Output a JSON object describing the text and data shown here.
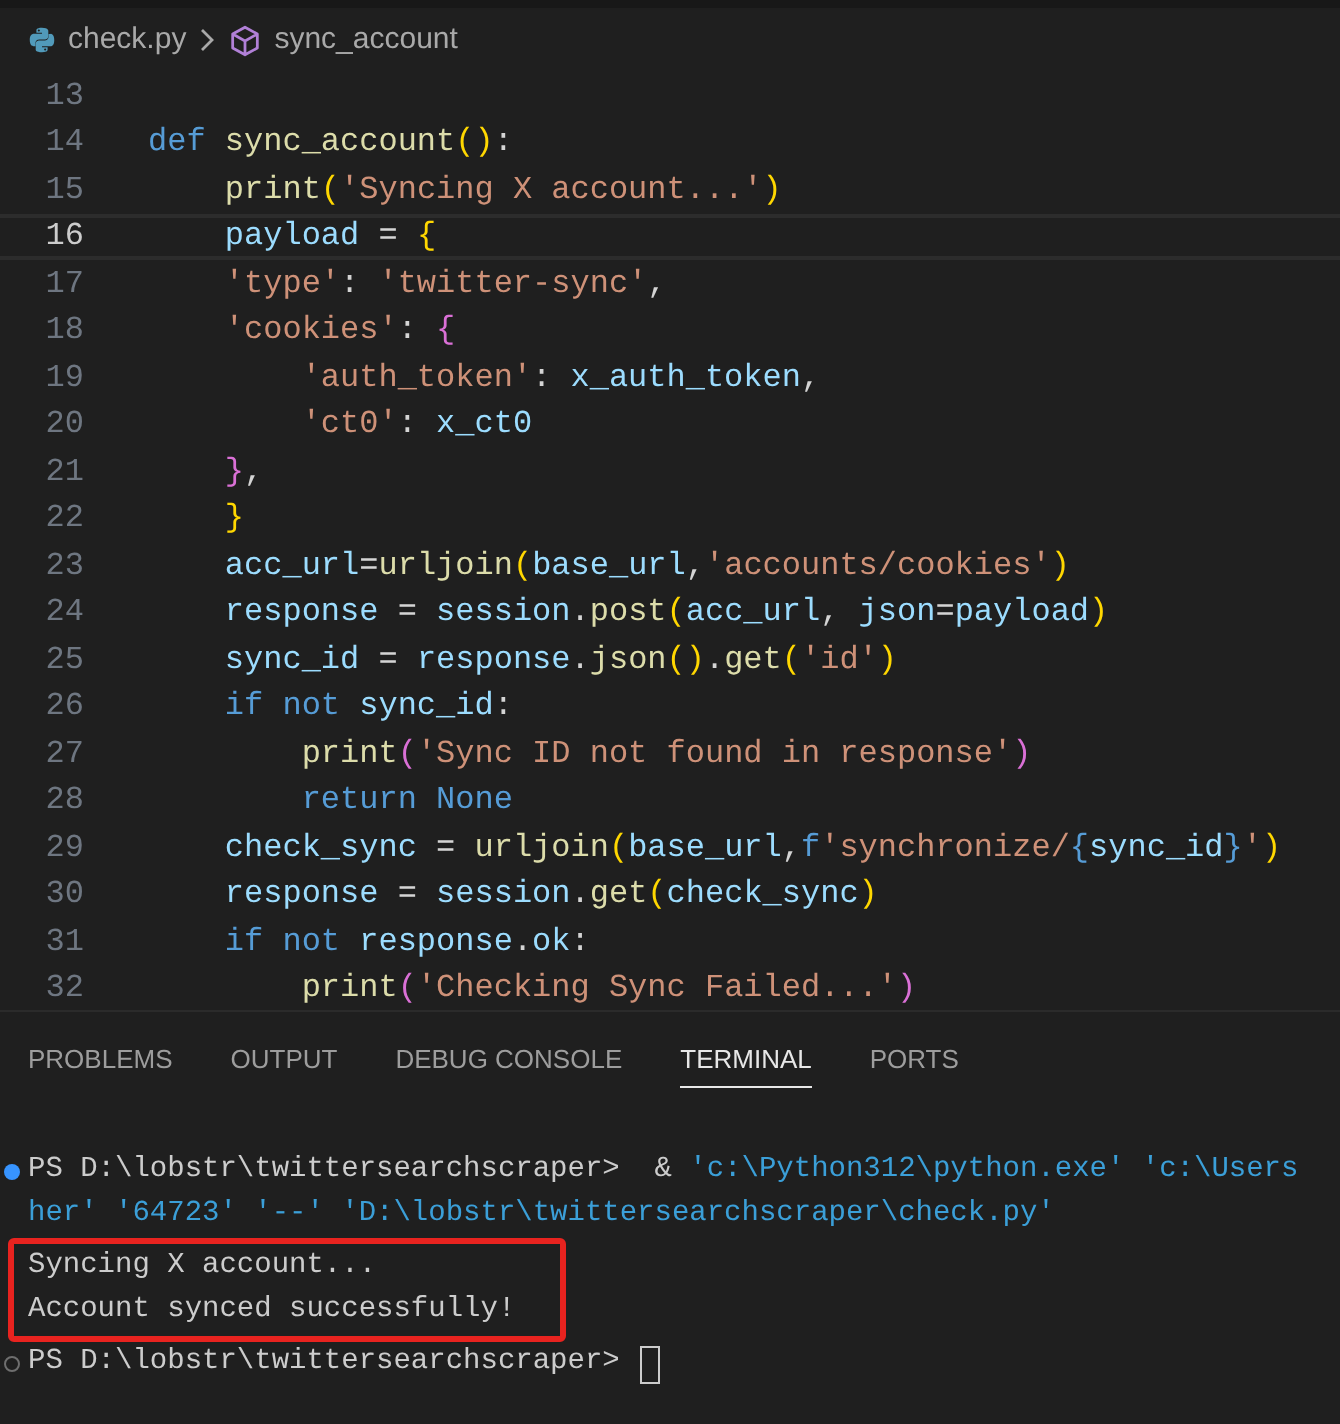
{
  "breadcrumb": {
    "file": "check.py",
    "symbol": "sync_account"
  },
  "editor": {
    "lines": [
      {
        "number": "13",
        "current": false
      },
      {
        "number": "14",
        "current": false,
        "tokens": [
          {
            "kind": "kw",
            "text": "def"
          },
          {
            "kind": "fn",
            "text": " sync_account"
          },
          {
            "kind": "br1",
            "text": "()"
          },
          {
            "kind": "plain",
            "text": ":"
          }
        ]
      },
      {
        "number": "15",
        "current": false,
        "tokens": [
          {
            "kind": "fn",
            "text": "    print"
          },
          {
            "kind": "br1",
            "text": "("
          },
          {
            "kind": "str",
            "text": "'Syncing X account...'"
          },
          {
            "kind": "br1",
            "text": ")"
          }
        ]
      },
      {
        "number": "16",
        "current": true,
        "tokens": [
          {
            "kind": "var",
            "text": "    payload"
          },
          {
            "kind": "plain",
            "text": " = "
          },
          {
            "kind": "br1",
            "text": "{"
          }
        ]
      },
      {
        "number": "17",
        "current": false,
        "tokens": [
          {
            "kind": "str",
            "text": "    'type'"
          },
          {
            "kind": "plain",
            "text": ": "
          },
          {
            "kind": "str",
            "text": "'twitter-sync'"
          },
          {
            "kind": "plain",
            "text": ","
          }
        ]
      },
      {
        "number": "18",
        "current": false,
        "tokens": [
          {
            "kind": "str",
            "text": "    'cookies'"
          },
          {
            "kind": "plain",
            "text": ": "
          },
          {
            "kind": "br2",
            "text": "{"
          }
        ]
      },
      {
        "number": "19",
        "current": false,
        "tokens": [
          {
            "kind": "str",
            "text": "        'auth_token'"
          },
          {
            "kind": "plain",
            "text": ": "
          },
          {
            "kind": "var",
            "text": "x_auth_token"
          },
          {
            "kind": "plain",
            "text": ","
          }
        ]
      },
      {
        "number": "20",
        "current": false,
        "tokens": [
          {
            "kind": "str",
            "text": "        'ct0'"
          },
          {
            "kind": "plain",
            "text": ": "
          },
          {
            "kind": "var",
            "text": "x_ct0"
          }
        ]
      },
      {
        "number": "21",
        "current": false,
        "tokens": [
          {
            "kind": "br2",
            "text": "    }"
          },
          {
            "kind": "plain",
            "text": ","
          }
        ]
      },
      {
        "number": "22",
        "current": false,
        "tokens": [
          {
            "kind": "br1",
            "text": "    }"
          }
        ]
      },
      {
        "number": "23",
        "current": false,
        "tokens": [
          {
            "kind": "var",
            "text": "    acc_url"
          },
          {
            "kind": "plain",
            "text": "="
          },
          {
            "kind": "fn",
            "text": "urljoin"
          },
          {
            "kind": "br1",
            "text": "("
          },
          {
            "kind": "var",
            "text": "base_url"
          },
          {
            "kind": "plain",
            "text": ","
          },
          {
            "kind": "str",
            "text": "'accounts/cookies'"
          },
          {
            "kind": "br1",
            "text": ")"
          }
        ]
      },
      {
        "number": "24",
        "current": false,
        "tokens": [
          {
            "kind": "var",
            "text": "    response"
          },
          {
            "kind": "plain",
            "text": " = "
          },
          {
            "kind": "var",
            "text": "session"
          },
          {
            "kind": "plain",
            "text": "."
          },
          {
            "kind": "fn",
            "text": "post"
          },
          {
            "kind": "br1",
            "text": "("
          },
          {
            "kind": "var",
            "text": "acc_url"
          },
          {
            "kind": "plain",
            "text": ", "
          },
          {
            "kind": "var",
            "text": "json"
          },
          {
            "kind": "plain",
            "text": "="
          },
          {
            "kind": "var",
            "text": "payload"
          },
          {
            "kind": "br1",
            "text": ")"
          }
        ]
      },
      {
        "number": "25",
        "current": false,
        "tokens": [
          {
            "kind": "var",
            "text": "    sync_id"
          },
          {
            "kind": "plain",
            "text": " = "
          },
          {
            "kind": "var",
            "text": "response"
          },
          {
            "kind": "plain",
            "text": "."
          },
          {
            "kind": "fn",
            "text": "json"
          },
          {
            "kind": "br1",
            "text": "()"
          },
          {
            "kind": "plain",
            "text": "."
          },
          {
            "kind": "fn",
            "text": "get"
          },
          {
            "kind": "br1",
            "text": "("
          },
          {
            "kind": "str",
            "text": "'id'"
          },
          {
            "kind": "br1",
            "text": ")"
          }
        ]
      },
      {
        "number": "26",
        "current": false,
        "tokens": [
          {
            "kind": "kw",
            "text": "    if not"
          },
          {
            "kind": "var",
            "text": " sync_id"
          },
          {
            "kind": "plain",
            "text": ":"
          }
        ]
      },
      {
        "number": "27",
        "current": false,
        "tokens": [
          {
            "kind": "fn",
            "text": "        print"
          },
          {
            "kind": "br2",
            "text": "("
          },
          {
            "kind": "str",
            "text": "'Sync ID not found in response'"
          },
          {
            "kind": "br2",
            "text": ")"
          }
        ]
      },
      {
        "number": "28",
        "current": false,
        "tokens": [
          {
            "kind": "kw",
            "text": "        return None"
          }
        ]
      },
      {
        "number": "29",
        "current": false,
        "tokens": [
          {
            "kind": "var",
            "text": "    check_sync"
          },
          {
            "kind": "plain",
            "text": " = "
          },
          {
            "kind": "fn",
            "text": "urljoin"
          },
          {
            "kind": "br1",
            "text": "("
          },
          {
            "kind": "var",
            "text": "base_url"
          },
          {
            "kind": "plain",
            "text": ","
          },
          {
            "kind": "kw",
            "text": "f"
          },
          {
            "kind": "str",
            "text": "'synchronize/"
          },
          {
            "kind": "kw",
            "text": "{"
          },
          {
            "kind": "var",
            "text": "sync_id"
          },
          {
            "kind": "kw",
            "text": "}"
          },
          {
            "kind": "str",
            "text": "'"
          },
          {
            "kind": "br1",
            "text": ")"
          }
        ]
      },
      {
        "number": "30",
        "current": false,
        "tokens": [
          {
            "kind": "var",
            "text": "    response"
          },
          {
            "kind": "plain",
            "text": " = "
          },
          {
            "kind": "var",
            "text": "session"
          },
          {
            "kind": "plain",
            "text": "."
          },
          {
            "kind": "fn",
            "text": "get"
          },
          {
            "kind": "br1",
            "text": "("
          },
          {
            "kind": "var",
            "text": "check_sync"
          },
          {
            "kind": "br1",
            "text": ")"
          }
        ]
      },
      {
        "number": "31",
        "current": false,
        "tokens": [
          {
            "kind": "kw",
            "text": "    if not"
          },
          {
            "kind": "var",
            "text": " response"
          },
          {
            "kind": "plain",
            "text": "."
          },
          {
            "kind": "var",
            "text": "ok"
          },
          {
            "kind": "plain",
            "text": ":"
          }
        ]
      },
      {
        "number": "32",
        "current": false,
        "tokens": [
          {
            "kind": "fn",
            "text": "        print"
          },
          {
            "kind": "br2",
            "text": "("
          },
          {
            "kind": "str",
            "text": "'Checking Sync Failed...'"
          },
          {
            "kind": "br2",
            "text": ")"
          }
        ]
      }
    ]
  },
  "panel_tabs": [
    {
      "label": "PROBLEMS",
      "selected": false
    },
    {
      "label": "OUTPUT",
      "selected": false
    },
    {
      "label": "DEBUG CONSOLE",
      "selected": false
    },
    {
      "label": "TERMINAL",
      "selected": true
    },
    {
      "label": "PORTS",
      "selected": false
    }
  ],
  "terminal": {
    "lines": [
      {
        "success_dot": true,
        "idle_circle": false,
        "boxed": false,
        "cursor": false,
        "segments": [
          {
            "kind": "plain",
            "text": "PS D:\\lobstr\\twittersearchscraper>  & "
          },
          {
            "kind": "str",
            "text": "'c:\\Python312\\python.exe' 'c:\\Users"
          }
        ]
      },
      {
        "success_dot": false,
        "idle_circle": false,
        "boxed": false,
        "cursor": false,
        "segments": [
          {
            "kind": "str",
            "text": "her' '64723' '--' 'D:\\lobstr\\twittersearchscraper\\check.py'"
          }
        ]
      },
      {
        "success_dot": false,
        "idle_circle": false,
        "boxed": true,
        "cursor": false,
        "segments": [
          {
            "kind": "plain",
            "text": "Syncing X account..."
          }
        ]
      },
      {
        "success_dot": false,
        "idle_circle": false,
        "boxed": true,
        "cursor": false,
        "segments": [
          {
            "kind": "plain",
            "text": "Account synced successfully!"
          }
        ]
      },
      {
        "success_dot": false,
        "idle_circle": true,
        "boxed": false,
        "cursor": true,
        "segments": [
          {
            "kind": "plain",
            "text": "PS D:\\lobstr\\twittersearchscraper> "
          }
        ]
      }
    ]
  }
}
